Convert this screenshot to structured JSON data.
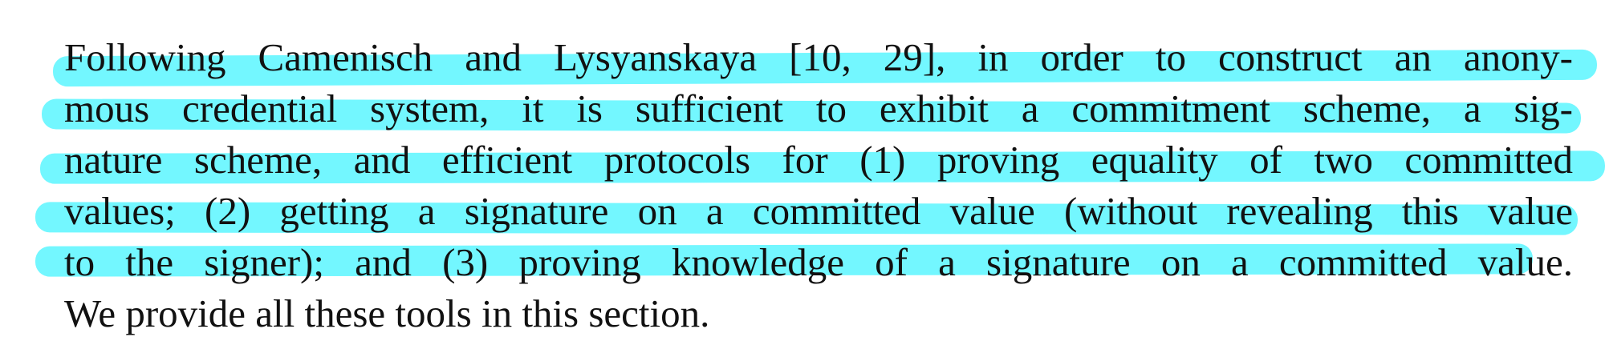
{
  "document": {
    "highlight_color": "#00f0ff",
    "text_color": "#111111",
    "lines": [
      "Following Camenisch and Lysyanskaya [10, 29], in order to construct an anony-",
      "mous credential system, it is sufficient to exhibit a commitment scheme, a sig-",
      "nature scheme, and efficient protocols for (1) proving equality of two committed",
      "values; (2) getting a signature on a committed value (without revealing this value",
      "to the signer); and (3) proving knowledge of a signature on a committed value.",
      "We provide all these tools in this section."
    ]
  }
}
